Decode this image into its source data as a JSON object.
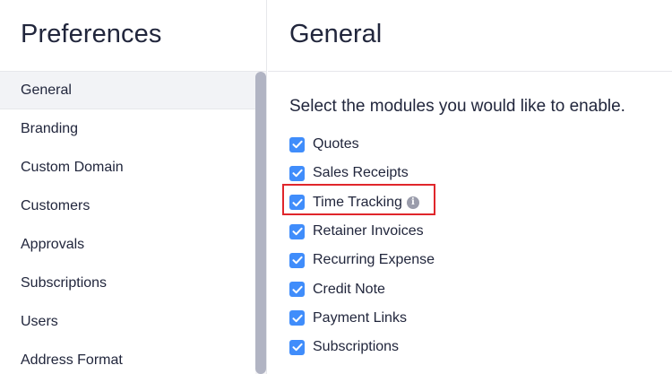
{
  "sidebar": {
    "title": "Preferences",
    "items": [
      {
        "label": "General",
        "active": true
      },
      {
        "label": "Branding"
      },
      {
        "label": "Custom Domain"
      },
      {
        "label": "Customers"
      },
      {
        "label": "Approvals"
      },
      {
        "label": "Subscriptions"
      },
      {
        "label": "Users"
      },
      {
        "label": "Address Format"
      }
    ]
  },
  "main": {
    "title": "General",
    "intro": "Select the modules you would like to enable.",
    "modules": [
      {
        "label": "Quotes",
        "checked": true
      },
      {
        "label": "Sales Receipts",
        "checked": true
      },
      {
        "label": "Time Tracking",
        "checked": true,
        "info_icon": "info-icon"
      },
      {
        "label": "Retainer Invoices",
        "checked": true
      },
      {
        "label": "Recurring Expense",
        "checked": true
      },
      {
        "label": "Credit Note",
        "checked": true
      },
      {
        "label": "Payment Links",
        "checked": true
      },
      {
        "label": "Subscriptions",
        "checked": true
      }
    ]
  },
  "colors": {
    "checkbox": "#408dfb",
    "highlight": "#e0262b",
    "active_bg": "#f2f3f6",
    "scroll_thumb": "#b1b4c3"
  }
}
